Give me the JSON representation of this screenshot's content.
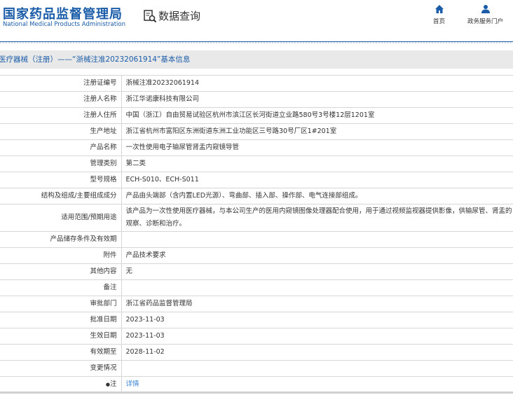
{
  "header": {
    "logo_cn": "国家药品监督管理局",
    "logo_en": "National Medical Products Administration",
    "section": "数据查询",
    "nav": [
      {
        "label": "首页",
        "icon": "home-icon"
      },
      {
        "label": "政务服务门户",
        "icon": "user-icon"
      }
    ]
  },
  "title": "医疗器械（注册）——“浙械注准20232061914”基本信息",
  "rows": [
    {
      "label": "注册证编号",
      "value": "浙械注准20232061914"
    },
    {
      "label": "注册人名称",
      "value": "浙江华诺康科技有限公司"
    },
    {
      "label": "注册人住所",
      "value": "中国（浙江）自由贸易试验区杭州市滨江区长河街道立业路580号3号楼12层1201室"
    },
    {
      "label": "生产地址",
      "value": "浙江省杭州市富阳区东洲街道东洲工业功能区三号路30号厂区1#201室"
    },
    {
      "label": "产品名称",
      "value": "一次性使用电子输尿管肾盂内窥镜导管"
    },
    {
      "label": "管理类别",
      "value": "第二类"
    },
    {
      "label": "型号规格",
      "value": "ECH-S010、ECH-S011"
    },
    {
      "label": "结构及组成/主要组成成分",
      "value": "产品由头端部（含内置LED光源）、弯曲部、插入部、操作部、电气连接部组成。"
    },
    {
      "label": "适用范围/预期用途",
      "value": "该产品为一次性使用医疗器械，与本公司生产的医用内窥镜图像处理器配合使用，用于通过视频监视器提供影像，供输尿管、肾盂的观察、诊断和治疗。"
    },
    {
      "label": "产品储存条件及有效期",
      "value": ""
    },
    {
      "label": "附件",
      "value": "产品技术要求"
    },
    {
      "label": "其他内容",
      "value": "无"
    },
    {
      "label": "备注",
      "value": ""
    },
    {
      "label": "审批部门",
      "value": "浙江省药品监督管理局"
    },
    {
      "label": "批准日期",
      "value": "2023-11-03"
    },
    {
      "label": "生效日期",
      "value": "2023-11-03"
    },
    {
      "label": "有效期至",
      "value": "2028-11-02"
    },
    {
      "label": "变更情况",
      "value": ""
    },
    {
      "label": "注",
      "value": "详情"
    }
  ],
  "colors": {
    "brand": "#1a5ca8",
    "link": "#2f7fd1"
  }
}
